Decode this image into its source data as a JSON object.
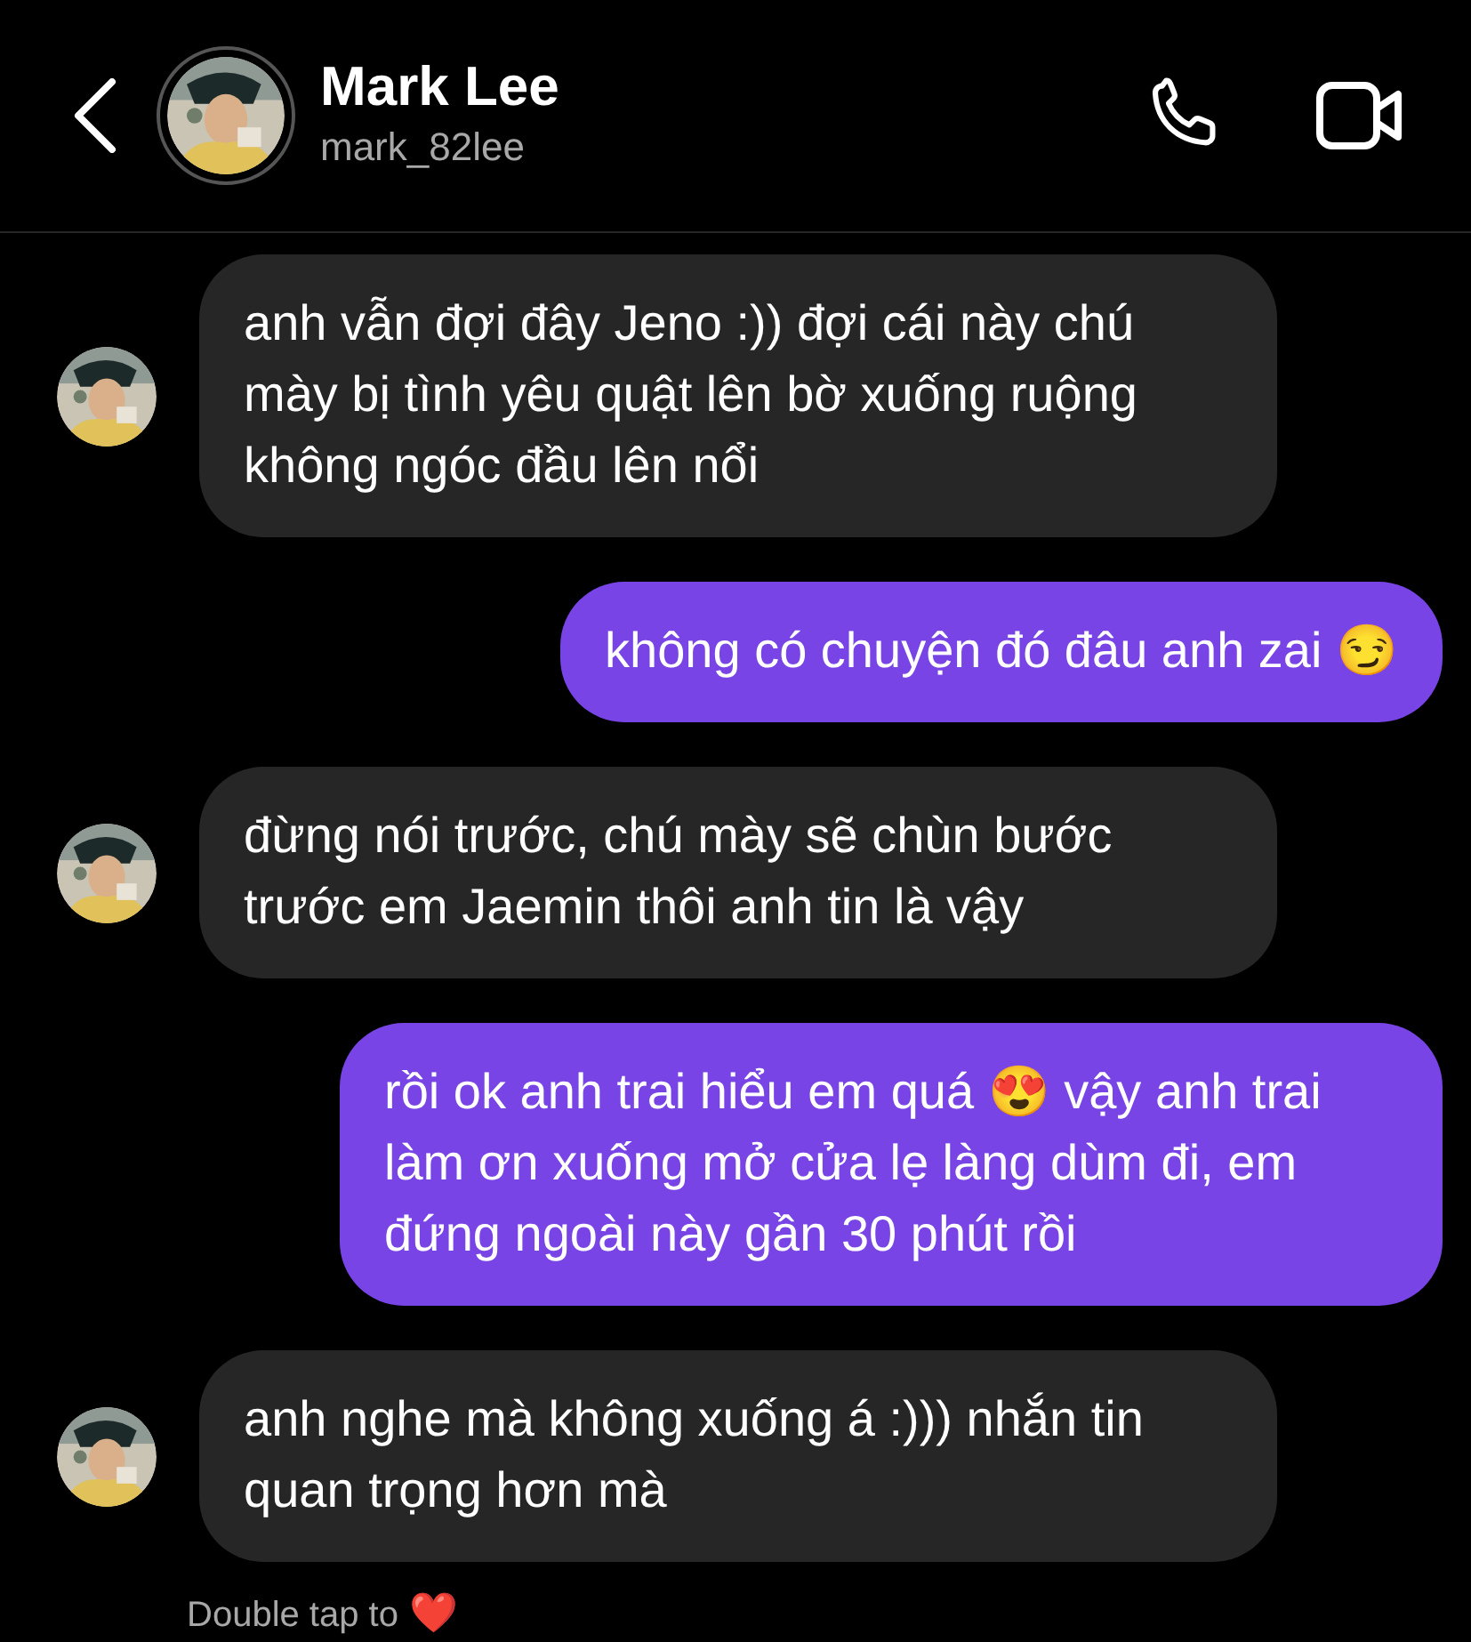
{
  "header": {
    "name": "Mark Lee",
    "username": "mark_82lee"
  },
  "messages": [
    {
      "kind": "received",
      "text": "anh vẫn đợi đây Jeno :)) đợi cái này chú mày bị tình yêu quật lên bờ xuống ruộng không ngóc đầu lên nổi"
    },
    {
      "kind": "sent",
      "text": "không có chuyện đó đâu anh zai 😏"
    },
    {
      "kind": "received",
      "text": "đừng nói trước, chú mày sẽ chùn bước trước em Jaemin thôi anh tin là vậy"
    },
    {
      "kind": "sent",
      "text": "rồi ok anh trai hiểu em quá 😍 vậy anh trai làm ơn xuống mở cửa lẹ làng dùm đi, em đứng ngoài này gần 30 phút rồi"
    },
    {
      "kind": "received",
      "text": "anh nghe mà không xuống á :))) nhắn tin quan trọng hơn mà"
    }
  ],
  "hint": {
    "text": "Double tap to",
    "emoji": "❤️"
  }
}
